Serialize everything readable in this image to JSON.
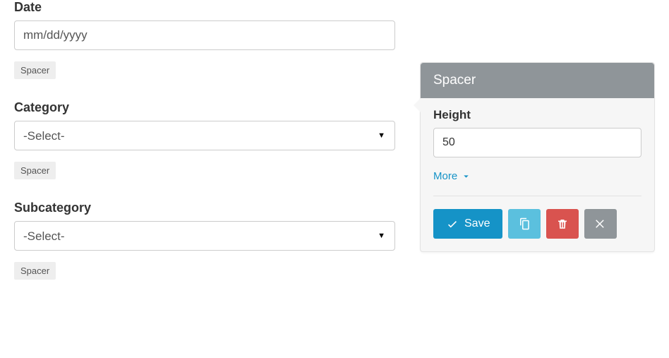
{
  "form": {
    "date": {
      "label": "Date",
      "placeholder": "mm/dd/yyyy",
      "value": ""
    },
    "category": {
      "label": "Category",
      "selected": "-Select-"
    },
    "subcategory": {
      "label": "Subcategory",
      "selected": "-Select-"
    },
    "spacer_label": "Spacer"
  },
  "popover": {
    "title": "Spacer",
    "height_label": "Height",
    "height_value": "50",
    "more_label": "More",
    "save_label": "Save"
  }
}
